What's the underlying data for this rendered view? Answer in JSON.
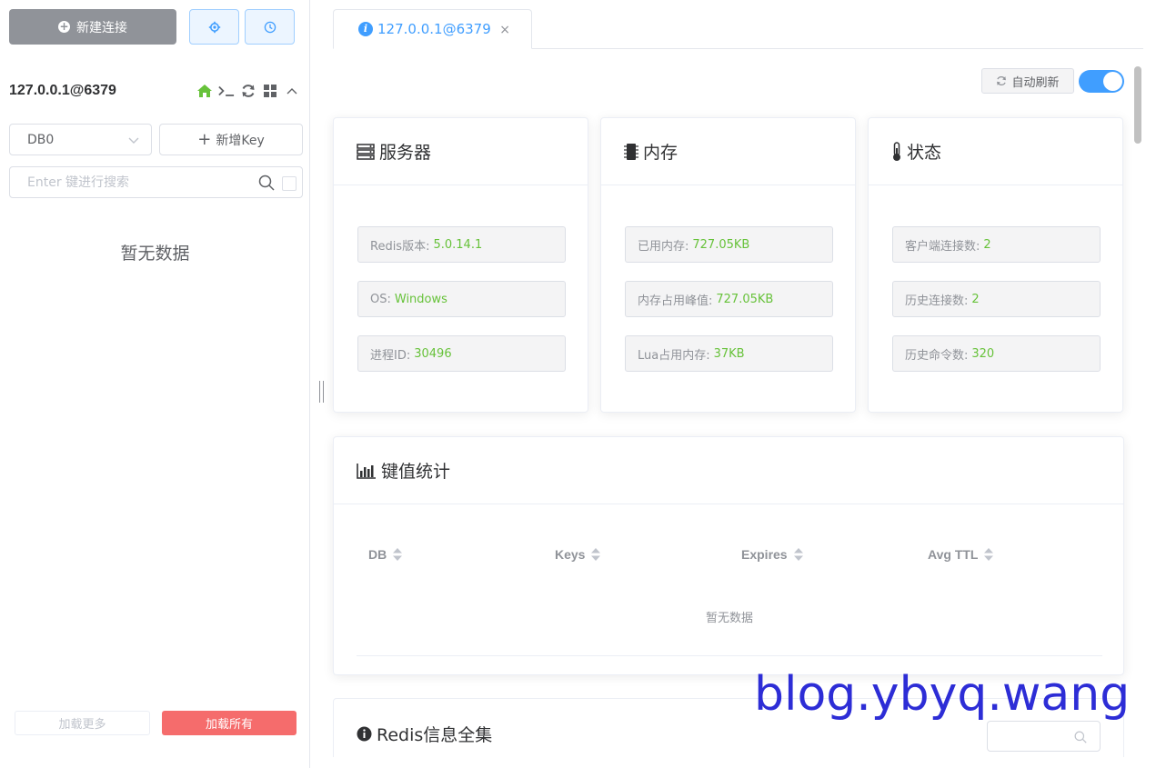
{
  "sidebar": {
    "new_connection_label": "新建连接",
    "connection_name": "127.0.0.1@6379",
    "db_select_value": "DB0",
    "add_key_label": "新增Key",
    "search_placeholder": "Enter 键进行搜索",
    "empty_text": "暂无数据",
    "load_more_label": "加载更多",
    "load_all_label": "加载所有"
  },
  "tab": {
    "label": "127.0.0.1@6379",
    "info_glyph": "i",
    "close_glyph": "×"
  },
  "toolbar": {
    "auto_refresh_label": "自动刷新",
    "auto_refresh_on": true
  },
  "server": {
    "title": "服务器",
    "items": [
      {
        "label": "Redis版本:",
        "value": "5.0.14.1"
      },
      {
        "label": "OS:",
        "value": "Windows"
      },
      {
        "label": "进程ID:",
        "value": "30496"
      }
    ]
  },
  "memory": {
    "title": "内存",
    "items": [
      {
        "label": "已用内存:",
        "value": "727.05KB"
      },
      {
        "label": "内存占用峰值:",
        "value": "727.05KB"
      },
      {
        "label": "Lua占用内存:",
        "value": "37KB"
      }
    ]
  },
  "status": {
    "title": "状态",
    "items": [
      {
        "label": "客户端连接数:",
        "value": "2"
      },
      {
        "label": "历史连接数:",
        "value": "2"
      },
      {
        "label": "历史命令数:",
        "value": "320"
      }
    ]
  },
  "key_stats": {
    "title": "键值统计",
    "columns": [
      "DB",
      "Keys",
      "Expires",
      "Avg TTL"
    ],
    "empty_text": "暂无数据"
  },
  "redis_info": {
    "title": "Redis信息全集"
  },
  "watermark": "blog.ybyq.wang",
  "colors": {
    "primary": "#409eff",
    "success_value": "#67c23a",
    "danger": "#f56c6c",
    "home_icon": "#67c23a",
    "watermark": "#2d2dd6"
  }
}
